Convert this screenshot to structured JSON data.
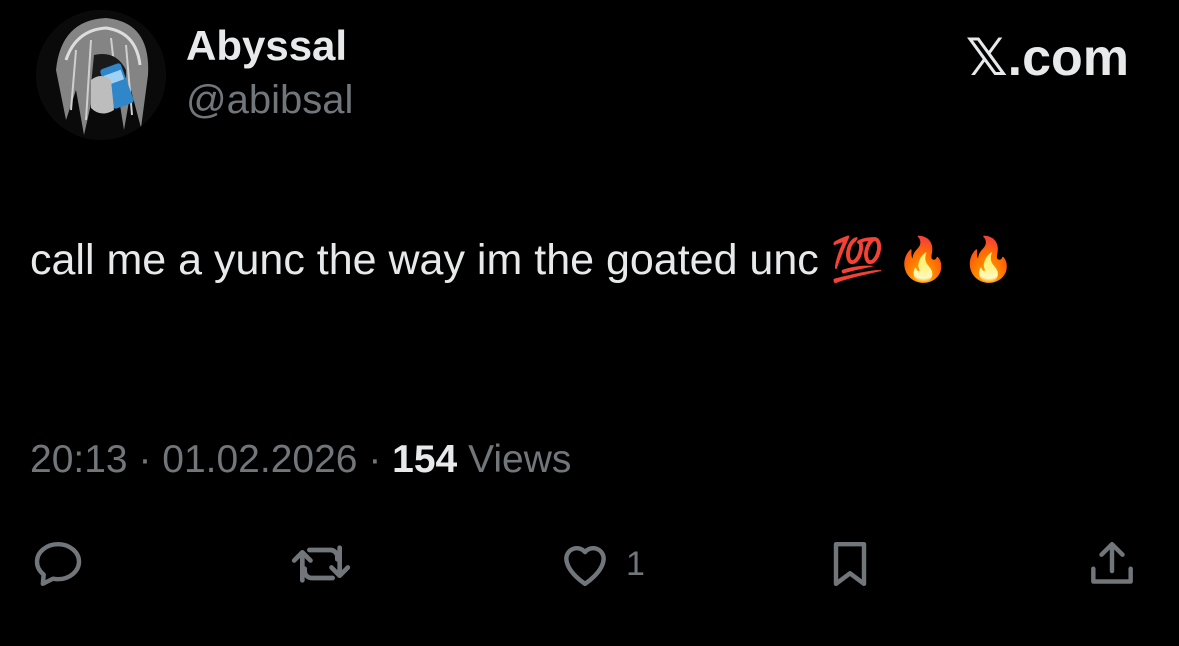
{
  "author": {
    "display_name": "Abyssal",
    "handle": "@abibsal"
  },
  "brand": {
    "label": "𝕏.com"
  },
  "tweet": {
    "text": "call me a yunc the way im the goated unc 💯 🔥 🔥"
  },
  "meta": {
    "time": "20:13",
    "separator": " · ",
    "date": "01.02.2026",
    "views_count": "154",
    "views_label": " Views"
  },
  "actions": {
    "reply_icon": "reply-icon",
    "repost_icon": "repost-icon",
    "like_icon": "heart-icon",
    "like_count": "1",
    "bookmark_icon": "bookmark-icon",
    "share_icon": "share-icon"
  },
  "colors": {
    "background": "#000000",
    "text_primary": "#e7e9ea",
    "text_secondary": "#71767b"
  }
}
